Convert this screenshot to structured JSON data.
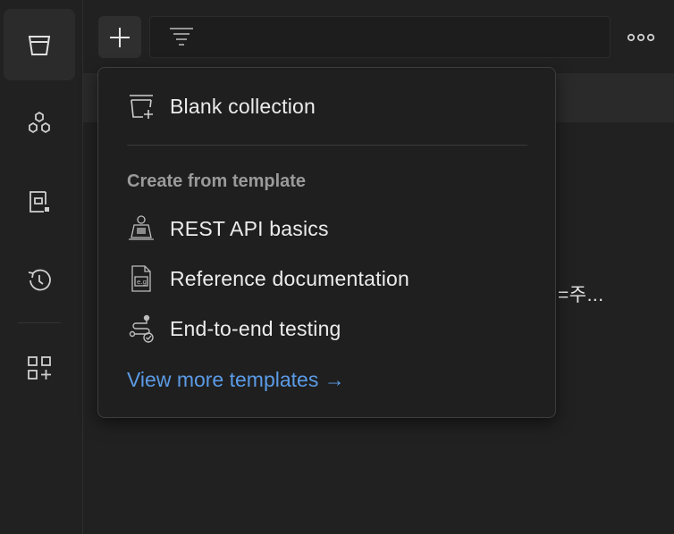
{
  "sidebar": {
    "items": [
      {
        "name": "collections",
        "icon": "collections-icon"
      },
      {
        "name": "apis",
        "icon": "apis-icon"
      },
      {
        "name": "environments",
        "icon": "environments-icon"
      },
      {
        "name": "history",
        "icon": "history-icon"
      },
      {
        "name": "more-apps",
        "icon": "apps-add-icon"
      }
    ]
  },
  "toolbar": {
    "new_icon": "plus-icon",
    "filter_icon": "filter-icon",
    "more_icon": "more-options-icon"
  },
  "background": {
    "truncated_text": "=주..."
  },
  "dropdown": {
    "blank_collection": "Blank collection",
    "section_title": "Create from template",
    "templates": [
      {
        "label": "REST API basics",
        "icon": "rest-api-template-icon"
      },
      {
        "label": "Reference documentation",
        "icon": "documentation-template-icon"
      },
      {
        "label": "End-to-end testing",
        "icon": "testing-template-icon"
      }
    ],
    "view_more": "View more templates →"
  },
  "colors": {
    "background": "#212121",
    "dropdown_bg": "#1f1f1f",
    "link": "#5b9be6",
    "section_title": "#9a9a9a"
  }
}
